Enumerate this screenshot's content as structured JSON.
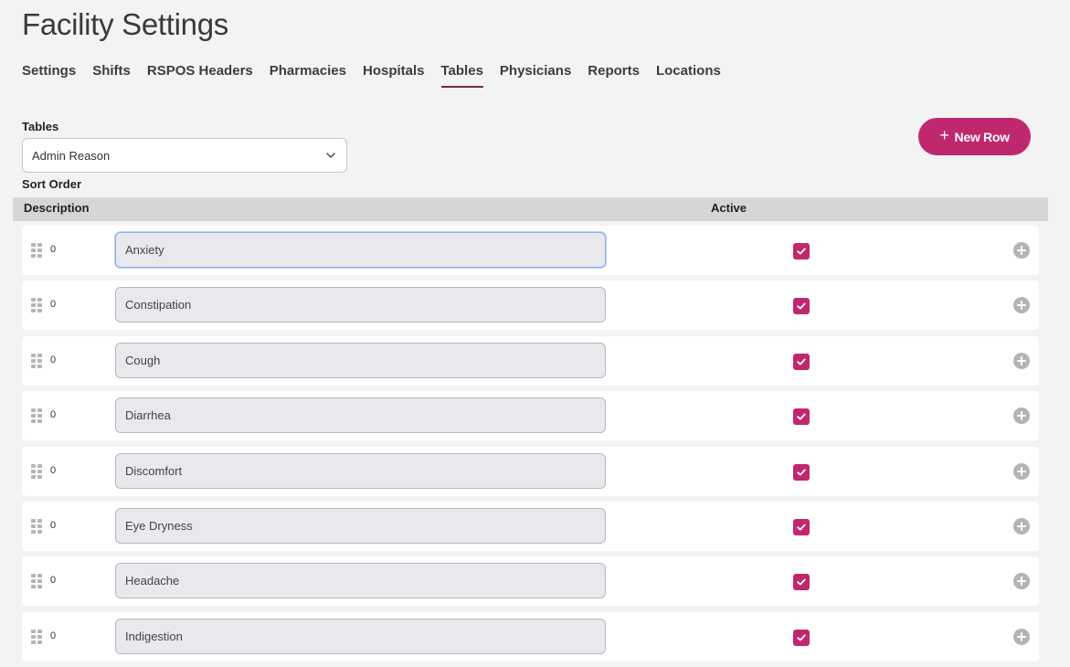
{
  "page": {
    "title": "Facility Settings"
  },
  "tabs": [
    {
      "label": "Settings",
      "active": false
    },
    {
      "label": "Shifts",
      "active": false
    },
    {
      "label": "RSPOS Headers",
      "active": false
    },
    {
      "label": "Pharmacies",
      "active": false
    },
    {
      "label": "Hospitals",
      "active": false
    },
    {
      "label": "Tables",
      "active": true
    },
    {
      "label": "Physicians",
      "active": false
    },
    {
      "label": "Reports",
      "active": false
    },
    {
      "label": "Locations",
      "active": false
    }
  ],
  "tables_select": {
    "label": "Tables",
    "selected": "Admin Reason"
  },
  "new_row_button": {
    "label": "New Row",
    "icon": "plus-icon"
  },
  "sort_order_label": "Sort Order",
  "table": {
    "columns": {
      "description": "Description",
      "active": "Active"
    },
    "rows": [
      {
        "sort": "0",
        "description": "Anxiety",
        "active": true,
        "focused": true
      },
      {
        "sort": "0",
        "description": "Constipation",
        "active": true,
        "focused": false
      },
      {
        "sort": "0",
        "description": "Cough",
        "active": true,
        "focused": false
      },
      {
        "sort": "0",
        "description": "Diarrhea",
        "active": true,
        "focused": false
      },
      {
        "sort": "0",
        "description": "Discomfort",
        "active": true,
        "focused": false
      },
      {
        "sort": "0",
        "description": "Eye Dryness",
        "active": true,
        "focused": false
      },
      {
        "sort": "0",
        "description": "Headache",
        "active": true,
        "focused": false
      },
      {
        "sort": "0",
        "description": "Indigestion",
        "active": true,
        "focused": false
      }
    ]
  },
  "colors": {
    "accent": "#c0286e",
    "tab_underline": "#7a2650",
    "header_bg": "#d6d6d6",
    "page_bg": "#f3f3f3"
  }
}
